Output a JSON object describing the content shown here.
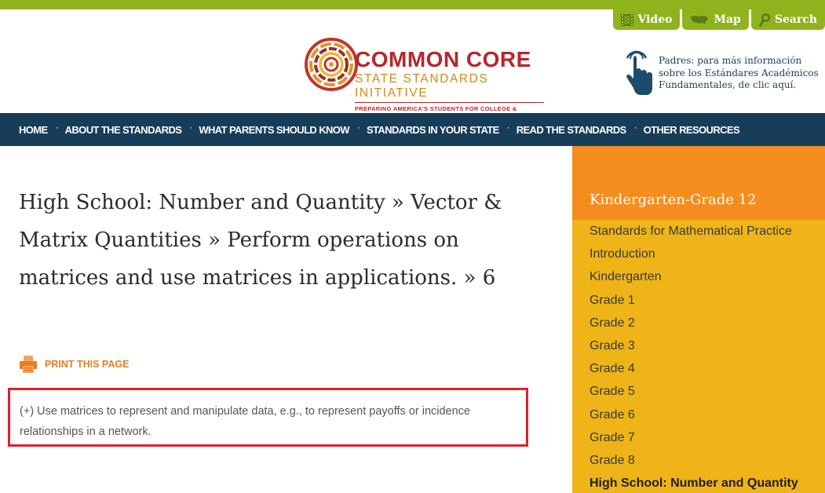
{
  "utility_nav": [
    {
      "label": "Video",
      "icon": "film-icon"
    },
    {
      "label": "Map",
      "icon": "us-map-icon"
    },
    {
      "label": "Search",
      "icon": "magnifier-icon"
    }
  ],
  "logo": {
    "title": "COMMON CORE",
    "subtitle": "STATE STANDARDS INITIATIVE",
    "tagline": "PREPARING AMERICA'S STUDENTS FOR COLLEGE & CAREER"
  },
  "parents_link": {
    "line1": "Padres: para más información",
    "line2": "sobre los Estándares Académicos",
    "line3": "Fundamentales, de clic aquí."
  },
  "main_nav": [
    "HOME",
    "ABOUT THE STANDARDS",
    "WHAT PARENTS SHOULD KNOW",
    "STANDARDS IN YOUR STATE",
    "READ THE STANDARDS",
    "OTHER RESOURCES"
  ],
  "page": {
    "title": "High School: Number and Quantity » Vector & Matrix Quantities » Perform operations on matrices and use matrices in applications. » 6",
    "print_label": "PRINT THIS PAGE",
    "standard_text": "(+) Use matrices to represent and manipulate data, e.g., to represent payoffs or incidence relationships in a network."
  },
  "sidebar": {
    "title": "Kindergarten-Grade 12",
    "items": [
      "Standards for Mathematical Practice",
      "Introduction",
      "Kindergarten",
      "Grade 1",
      "Grade 2",
      "Grade 3",
      "Grade 4",
      "Grade 5",
      "Grade 6",
      "Grade 7",
      "Grade 8",
      "High School: Number and Quantity"
    ],
    "active_index": 11
  },
  "colors": {
    "top_bar": "#8fb31d",
    "nav_bg": "#173d58",
    "sidebar_head": "#f58d1e",
    "sidebar_body": "#eeb418",
    "highlight_border": "#e0202a",
    "print_accent": "#e67e22"
  }
}
